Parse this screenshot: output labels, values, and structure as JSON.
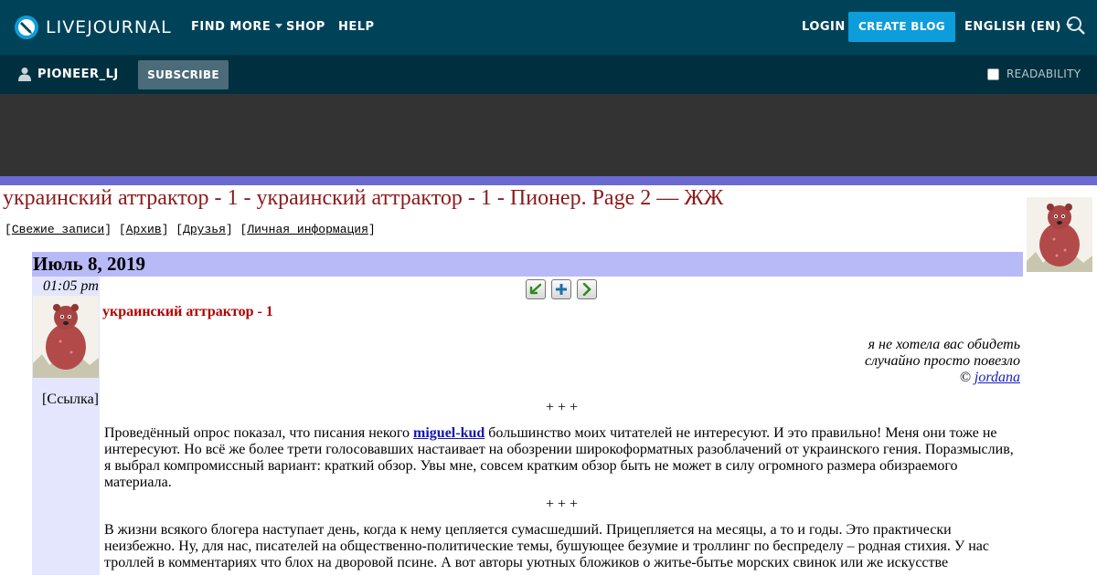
{
  "topbar": {
    "logo_text": "LIVEJOURNAL",
    "find_more": "FIND MORE",
    "shop": "SHOP",
    "help": "HELP",
    "login": "LOGIN",
    "create_blog": "CREATE BLOG",
    "language": "ENGLISH (EN)"
  },
  "subbar": {
    "username": "PIONEER_LJ",
    "subscribe": "SUBSCRIBE",
    "readability": "READABILITY"
  },
  "journal": {
    "title": "украинский аттрактор - 1 - украинский аттрактор - 1 - Пионер. Page 2 — ЖЖ",
    "links": [
      "Свежие записи",
      "Архив",
      "Друзья",
      "Личная информация"
    ]
  },
  "entry": {
    "date": "Июль 8, 2019",
    "time": "01:05 pm",
    "link_label": "[Ссылка]",
    "title": "украинский аттрактор - 1",
    "epigraph": {
      "line1": "я не хотела вас обидеть",
      "line2": "случайно просто повезло",
      "copyright_prefix": "© ",
      "author": "jordana"
    },
    "separator": "+ + +",
    "para1_before": "Проведённый опрос показал, что писания некого ",
    "para1_link": "miguel-kud",
    "para1_after": " большинство моих читателей не интересуют. И это правильно! Меня они тоже не интересуют. Но всё же более трети голосовавших настаивает на обозрении широкоформатных разоблачений от украинского гения. Поразмыслив, я выбрал компромиссный вариант: краткий обзор. Увы мне, совсем кратким обзор быть не может в силу огромного размера обизраемого материала.",
    "para2": "В жизни всякого блогера наступает день, когда к нему цепляется сумасшедший. Прицепляется на месяцы, а то и годы. Это практически неизбежно. Ну, для нас, писателей на общественно-политические темы, бушующее безумие и троллинг по беспределу – родная стихия. У нас троллей в комментариях что блох на дворовой псине. А вот авторы уютных бложиков о житье-бытье морских свинок или же искусстве"
  },
  "colors": {
    "topbar": "#004359",
    "subbar": "#00303f",
    "accent": "#0d9ddb",
    "date_bar": "#b8baf8",
    "title": "#8b1a1a"
  }
}
